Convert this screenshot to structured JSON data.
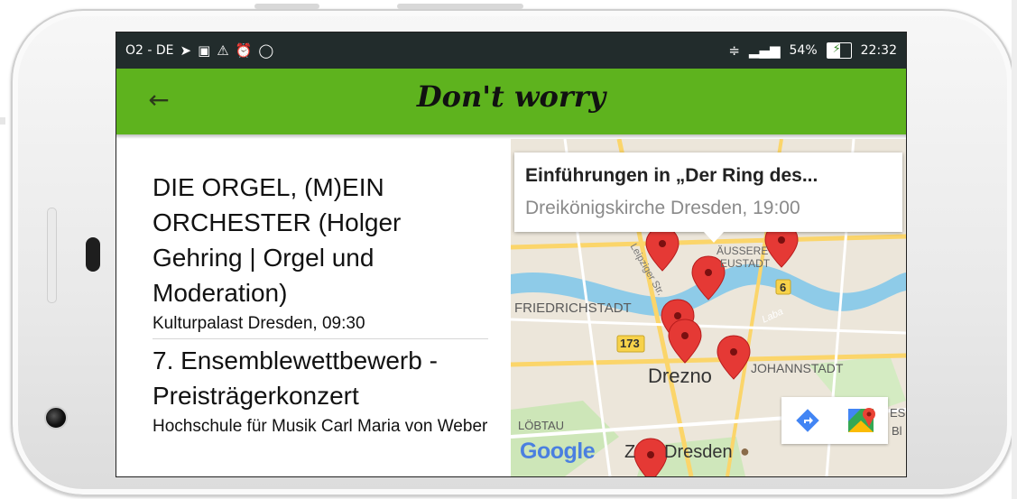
{
  "status_bar": {
    "carrier": "O2 - DE",
    "notification_icons": [
      "navigation-icon",
      "image-icon",
      "warning-icon",
      "alarm-icon",
      "shield-icon"
    ],
    "battery_percent": "54%",
    "battery_level": 0.54,
    "time": "22:32"
  },
  "app_bar": {
    "title": "Don't worry",
    "back_icon": "arrow-back-icon",
    "color": "#5eb31e"
  },
  "events": [
    {
      "title": "DIE ORGEL, (M)EIN ORCHESTER (Holger Gehring | Orgel und Moderation)",
      "venue_time": "Kulturpalast Dresden, 09:30"
    },
    {
      "title": "7. Ensemblewettbewerb - Preisträgerkonzert",
      "venue_time": "Hochschule für Musik Carl Maria von Weber"
    }
  ],
  "map": {
    "info_window": {
      "title": "Einführungen in „Der Ring des...",
      "subtitle": "Dreikönigskirche Dresden, 19:00"
    },
    "labels": {
      "friedrichstadt": "FRIEDRICHSTADT",
      "city": "Drezno",
      "johannstadt": "JOHANNSTADT",
      "aussere_neustadt_1": "ÄUSSERE",
      "aussere_neustadt_2": "EUSTADT",
      "road_173": "173",
      "road_6": "6",
      "leipziger": "Leipziger Str.",
      "lobtau": "LÖBTAU",
      "zoo_prefix": "Z",
      "zoo": "Dresden",
      "elbe": "Laba",
      "east_edge_1": "ES",
      "east_edge_2": "Bl"
    },
    "google": "Google",
    "controls": {
      "directions_icon": "directions-icon",
      "maps_icon": "google-maps-icon"
    },
    "marker_color": "#e53935"
  }
}
